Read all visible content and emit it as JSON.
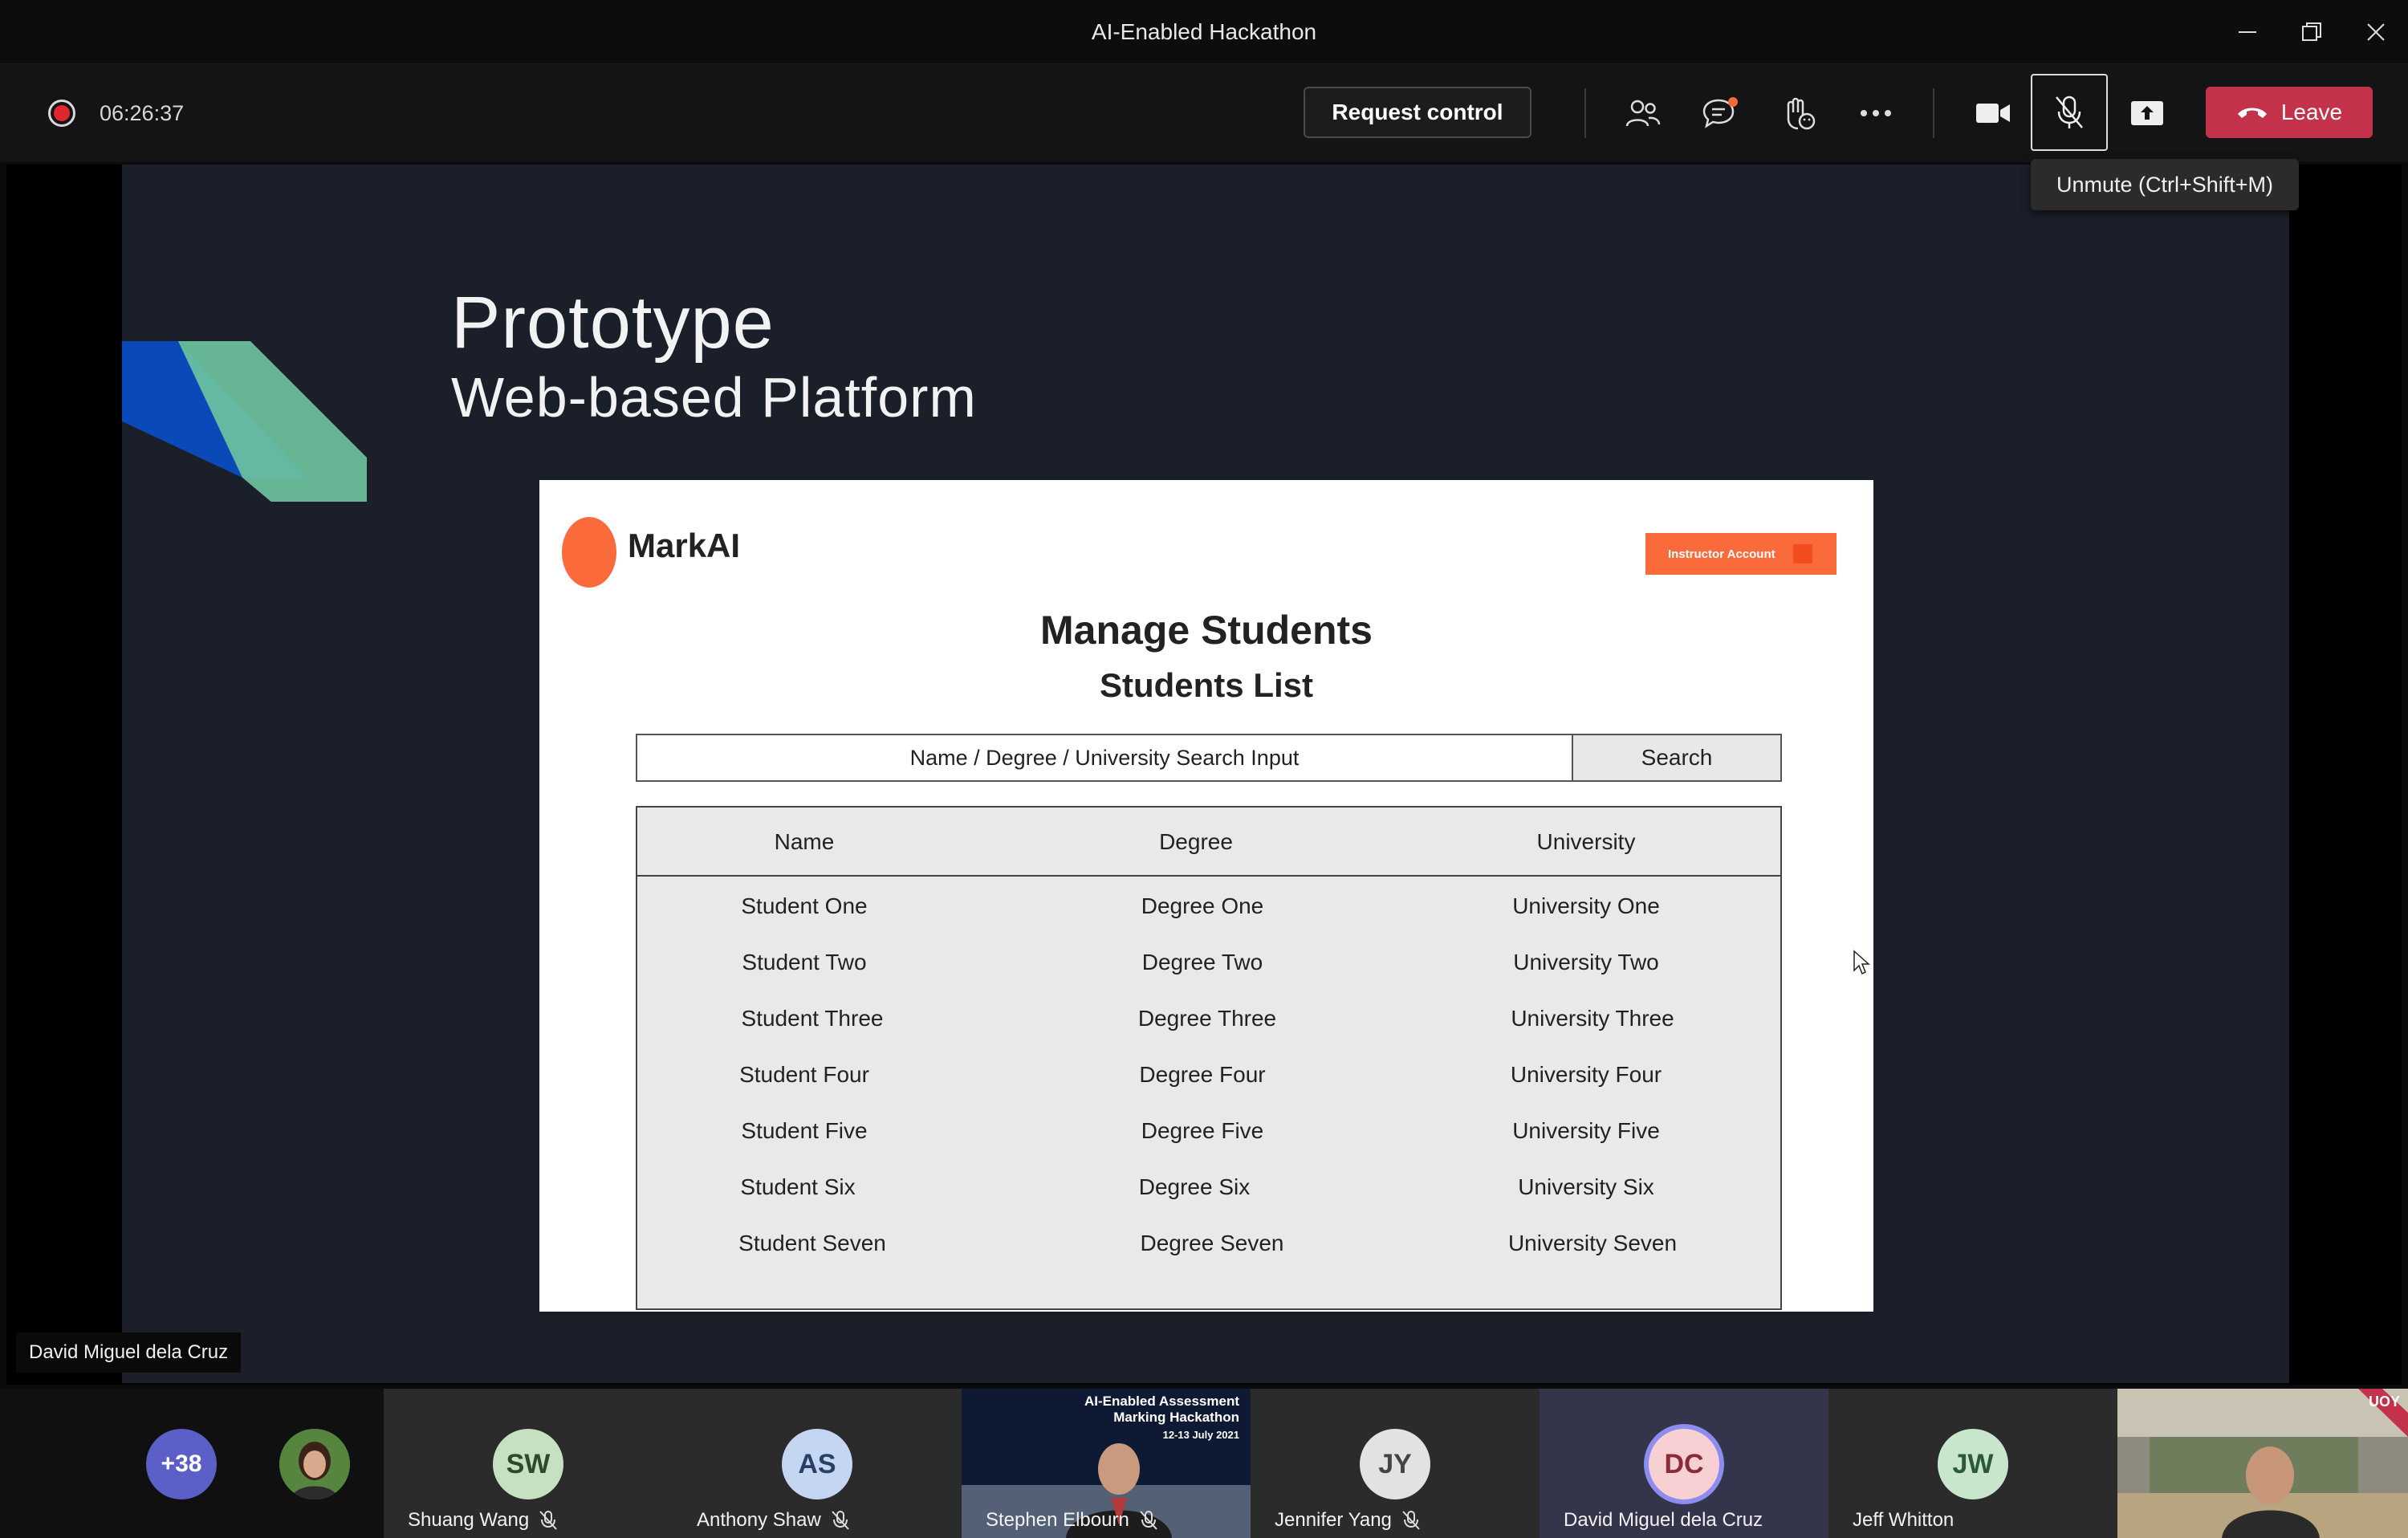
{
  "window": {
    "title": "AI-Enabled Hackathon"
  },
  "toolbar": {
    "timer": "06:26:37",
    "request_control": "Request control",
    "leave": "Leave",
    "tooltip": "Unmute (Ctrl+Shift+M)",
    "leave_color": "#c4314b"
  },
  "slide": {
    "title": "Prototype",
    "subtitle": "Web-based Platform",
    "mockup": {
      "brand": "MarkAI",
      "account_button": "Instructor Account",
      "heading": "Manage Students",
      "subheading": "Students List",
      "search_placeholder": "Name / Degree / University Search Input",
      "search_button": "Search",
      "columns": [
        "Name",
        "Degree",
        "University"
      ],
      "rows": [
        [
          "Student One",
          "Degree One",
          "University One"
        ],
        [
          "Student Two",
          "Degree Two",
          "University Two"
        ],
        [
          "Student Three",
          "Degree Three",
          "University Three"
        ],
        [
          "Student Four",
          "Degree Four",
          "University Four"
        ],
        [
          "Student Five",
          "Degree Five",
          "University Five"
        ],
        [
          "Student Six",
          "Degree Six",
          "University Six"
        ],
        [
          "Student Seven",
          "Degree Seven",
          "University Seven"
        ]
      ],
      "accent_color": "#fb6a3b"
    }
  },
  "presenter_label": "David Miguel dela Cruz",
  "participants": {
    "more_count": "+38",
    "tiles": [
      {
        "initials": "SW",
        "name": "Shuang Wang",
        "muted": true
      },
      {
        "initials": "AS",
        "name": "Anthony Shaw",
        "muted": true
      },
      {
        "initials": "",
        "name": "Stephen Elbourn",
        "muted": true,
        "poster_title": "AI-Enabled Assessment Marking Hackathon",
        "poster_date": "12-13 July 2021"
      },
      {
        "initials": "JY",
        "name": "Jennifer Yang",
        "muted": true
      },
      {
        "initials": "DC",
        "name": "David Miguel dela Cruz",
        "muted": false
      },
      {
        "initials": "JW",
        "name": "Jeff Whitton",
        "muted": false
      }
    ],
    "video_badge": "UOY"
  }
}
